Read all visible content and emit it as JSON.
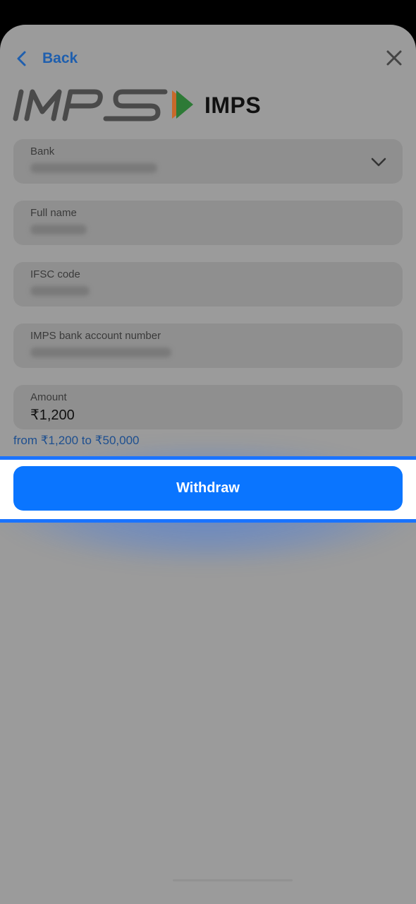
{
  "header": {
    "back_label": "Back",
    "close_icon": "close-icon",
    "back_icon": "chevron-left-icon"
  },
  "method": {
    "logo_text": "IMPS",
    "title": "IMPS"
  },
  "form": {
    "bank": {
      "label": "Bank",
      "value_hidden": true
    },
    "full_name": {
      "label": "Full name",
      "value_hidden": true
    },
    "ifsc": {
      "label": "IFSC code",
      "value_hidden": true
    },
    "account": {
      "label": "IMPS bank account number",
      "value_hidden": true
    },
    "amount": {
      "label": "Amount",
      "value": "₹1,200"
    },
    "range_hint": "from ₹1,200 to ₹50,000"
  },
  "actions": {
    "withdraw_label": "Withdraw"
  },
  "colors": {
    "accent_blue": "#0a75ff",
    "link_blue": "#1f5fae",
    "highlight_border": "#1a73ff",
    "overlay_gray": "#9b9b9b"
  }
}
